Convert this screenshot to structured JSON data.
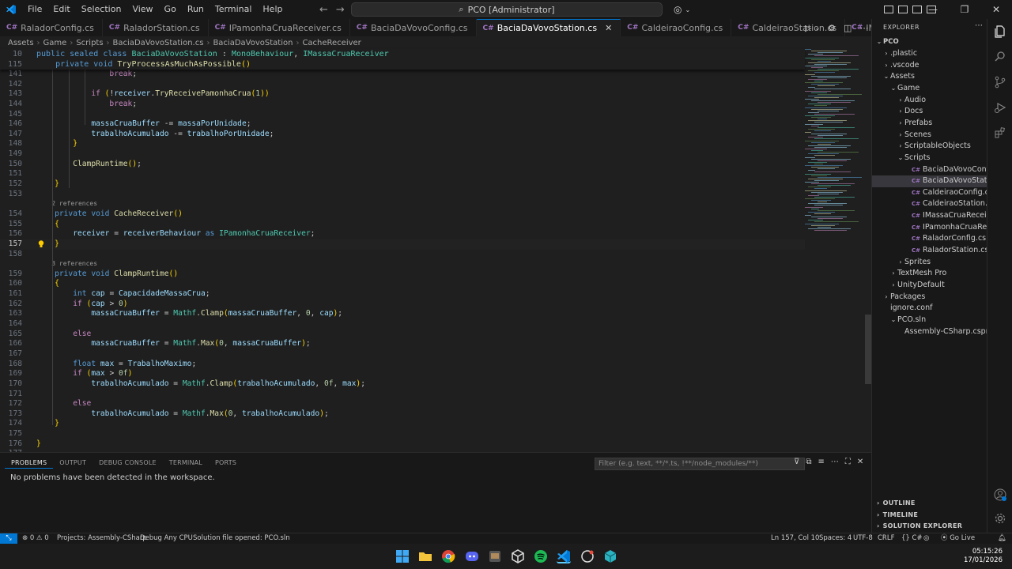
{
  "titlebar": {
    "menus": [
      "File",
      "Edit",
      "Selection",
      "View",
      "Go",
      "Run",
      "Terminal",
      "Help"
    ],
    "command_center": "PCO [Administrator]"
  },
  "tabs": [
    {
      "label": "RaladorConfig.cs",
      "active": false
    },
    {
      "label": "RaladorStation.cs",
      "active": false
    },
    {
      "label": "IPamonhaCruaReceiver.cs",
      "active": false
    },
    {
      "label": "BaciaDaVovoConfig.cs",
      "active": false
    },
    {
      "label": "BaciaDaVovoStation.cs",
      "active": true
    },
    {
      "label": "CaldeiraoConfig.cs",
      "active": false
    },
    {
      "label": "CaldeiraoStation.cs",
      "active": false
    },
    {
      "label": "IMassaCruaReceiver.cs",
      "active": false
    }
  ],
  "breadcrumb": [
    "Assets",
    "Game",
    "Scripts",
    "BaciaDaVovoStation.cs",
    "BaciaDaVovoStation",
    "CacheReceiver"
  ],
  "sticky": [
    {
      "num": "10",
      "text": "public sealed class BaciaDaVovoStation : MonoBehaviour, IMassaCruaReceiver"
    },
    {
      "num": "115",
      "text": "    private void TryProcessAsMuchAsPossible()"
    }
  ],
  "code_lines": [
    {
      "num": "141",
      "text": "                break;"
    },
    {
      "num": "142",
      "text": ""
    },
    {
      "num": "143",
      "text": "            if (!receiver.TryReceivePamonhaCrua(1))"
    },
    {
      "num": "144",
      "text": "                break;"
    },
    {
      "num": "145",
      "text": ""
    },
    {
      "num": "146",
      "text": "            massaCruaBuffer -= massaPorUnidade;"
    },
    {
      "num": "147",
      "text": "            trabalhoAcumulado -= trabalhoPorUnidade;"
    },
    {
      "num": "148",
      "text": "        }"
    },
    {
      "num": "149",
      "text": ""
    },
    {
      "num": "150",
      "text": "        ClampRuntime();"
    },
    {
      "num": "151",
      "text": ""
    },
    {
      "num": "152",
      "text": "    }"
    },
    {
      "num": "153",
      "text": ""
    },
    {
      "num": "",
      "text": "    2 references",
      "lens": true
    },
    {
      "num": "154",
      "text": "    private void CacheReceiver()"
    },
    {
      "num": "155",
      "text": "    {"
    },
    {
      "num": "156",
      "text": "        receiver = receiverBehaviour as IPamonhaCruaReceiver;"
    },
    {
      "num": "157",
      "text": "    }"
    },
    {
      "num": "158",
      "text": ""
    },
    {
      "num": "",
      "text": "    3 references",
      "lens": true
    },
    {
      "num": "159",
      "text": "    private void ClampRuntime()"
    },
    {
      "num": "160",
      "text": "    {"
    },
    {
      "num": "161",
      "text": "        int cap = CapacidadeMassaCrua;"
    },
    {
      "num": "162",
      "text": "        if (cap > 0)"
    },
    {
      "num": "163",
      "text": "            massaCruaBuffer = Mathf.Clamp(massaCruaBuffer, 0, cap);"
    },
    {
      "num": "164",
      "text": ""
    },
    {
      "num": "165",
      "text": "        else"
    },
    {
      "num": "166",
      "text": "            massaCruaBuffer = Mathf.Max(0, massaCruaBuffer);"
    },
    {
      "num": "167",
      "text": ""
    },
    {
      "num": "168",
      "text": "        float max = TrabalhoMaximo;"
    },
    {
      "num": "169",
      "text": "        if (max > 0f)"
    },
    {
      "num": "170",
      "text": "            trabalhoAcumulado = Mathf.Clamp(trabalhoAcumulado, 0f, max);"
    },
    {
      "num": "171",
      "text": ""
    },
    {
      "num": "172",
      "text": "        else"
    },
    {
      "num": "173",
      "text": "            trabalhoAcumulado = Mathf.Max(0, trabalhoAcumulado);"
    },
    {
      "num": "174",
      "text": "    }"
    },
    {
      "num": "175",
      "text": ""
    },
    {
      "num": "176",
      "text": "}"
    },
    {
      "num": "177",
      "text": ""
    }
  ],
  "panel": {
    "tabs": [
      "PROBLEMS",
      "OUTPUT",
      "DEBUG CONSOLE",
      "TERMINAL",
      "PORTS"
    ],
    "filter_placeholder": "Filter (e.g. text, **/*.ts, !**/node_modules/**)",
    "message": "No problems have been detected in the workspace."
  },
  "explorer": {
    "title": "EXPLORER",
    "root": "PCO",
    "items": [
      {
        "label": ".plastic",
        "indent": 1,
        "chev": "›",
        "file": false
      },
      {
        "label": ".vscode",
        "indent": 1,
        "chev": "›",
        "file": false
      },
      {
        "label": "Assets",
        "indent": 1,
        "chev": "⌄",
        "file": false
      },
      {
        "label": "Game",
        "indent": 2,
        "chev": "⌄",
        "file": false
      },
      {
        "label": "Audio",
        "indent": 3,
        "chev": "›",
        "file": false
      },
      {
        "label": "Docs",
        "indent": 3,
        "chev": "›",
        "file": false
      },
      {
        "label": "Prefabs",
        "indent": 3,
        "chev": "›",
        "file": false
      },
      {
        "label": "Scenes",
        "indent": 3,
        "chev": "›",
        "file": false
      },
      {
        "label": "ScriptableObjects",
        "indent": 3,
        "chev": "›",
        "file": false
      },
      {
        "label": "Scripts",
        "indent": 3,
        "chev": "⌄",
        "file": false
      },
      {
        "label": "BaciaDaVovoConfig.cs",
        "indent": 4,
        "chev": "",
        "file": true
      },
      {
        "label": "BaciaDaVovoStation.cs",
        "indent": 4,
        "chev": "",
        "file": true,
        "selected": true
      },
      {
        "label": "CaldeiraoConfig.cs",
        "indent": 4,
        "chev": "",
        "file": true
      },
      {
        "label": "CaldeiraoStation.cs",
        "indent": 4,
        "chev": "",
        "file": true
      },
      {
        "label": "IMassaCruaReceiver.cs",
        "indent": 4,
        "chev": "",
        "file": true
      },
      {
        "label": "IPamonhaCruaReceiver.cs",
        "indent": 4,
        "chev": "",
        "file": true
      },
      {
        "label": "RaladorConfig.cs",
        "indent": 4,
        "chev": "",
        "file": true
      },
      {
        "label": "RaladorStation.cs",
        "indent": 4,
        "chev": "",
        "file": true
      },
      {
        "label": "Sprites",
        "indent": 3,
        "chev": "›",
        "file": false
      },
      {
        "label": "TextMesh Pro",
        "indent": 2,
        "chev": "›",
        "file": false
      },
      {
        "label": "UnityDefault",
        "indent": 2,
        "chev": "›",
        "file": false
      },
      {
        "label": "Packages",
        "indent": 1,
        "chev": "›",
        "file": false
      },
      {
        "label": "ignore.conf",
        "indent": 1,
        "chev": "",
        "file": false
      },
      {
        "label": "PCO.sln",
        "indent": 2,
        "chev": "⌄",
        "file": false
      },
      {
        "label": "Assembly-CSharp.csproj",
        "indent": 3,
        "chev": "",
        "file": false
      }
    ],
    "sections": [
      "OUTLINE",
      "TIMELINE",
      "SOLUTION EXPLORER"
    ]
  },
  "statusbar": {
    "problems": "⊗ 0  ⚠ 0",
    "projects": "Projects: Assembly-CSharp",
    "debug": "Debug Any CPU",
    "solution": "Solution file opened: PCO.sln",
    "position": "Ln 157, Col 10",
    "spaces": "Spaces: 4",
    "encoding": "UTF-8",
    "eol": "CRLF",
    "language": "{} C#",
    "golive": "Go Live"
  },
  "clock": {
    "time": "05:15:26",
    "date": "17/01/2026"
  },
  "colors": {
    "accent": "#0078d4",
    "keyword": "#569cd6",
    "type": "#4ec9b0",
    "function": "#dcdcaa",
    "variable": "#9cdcfe",
    "number": "#b5cea8"
  }
}
